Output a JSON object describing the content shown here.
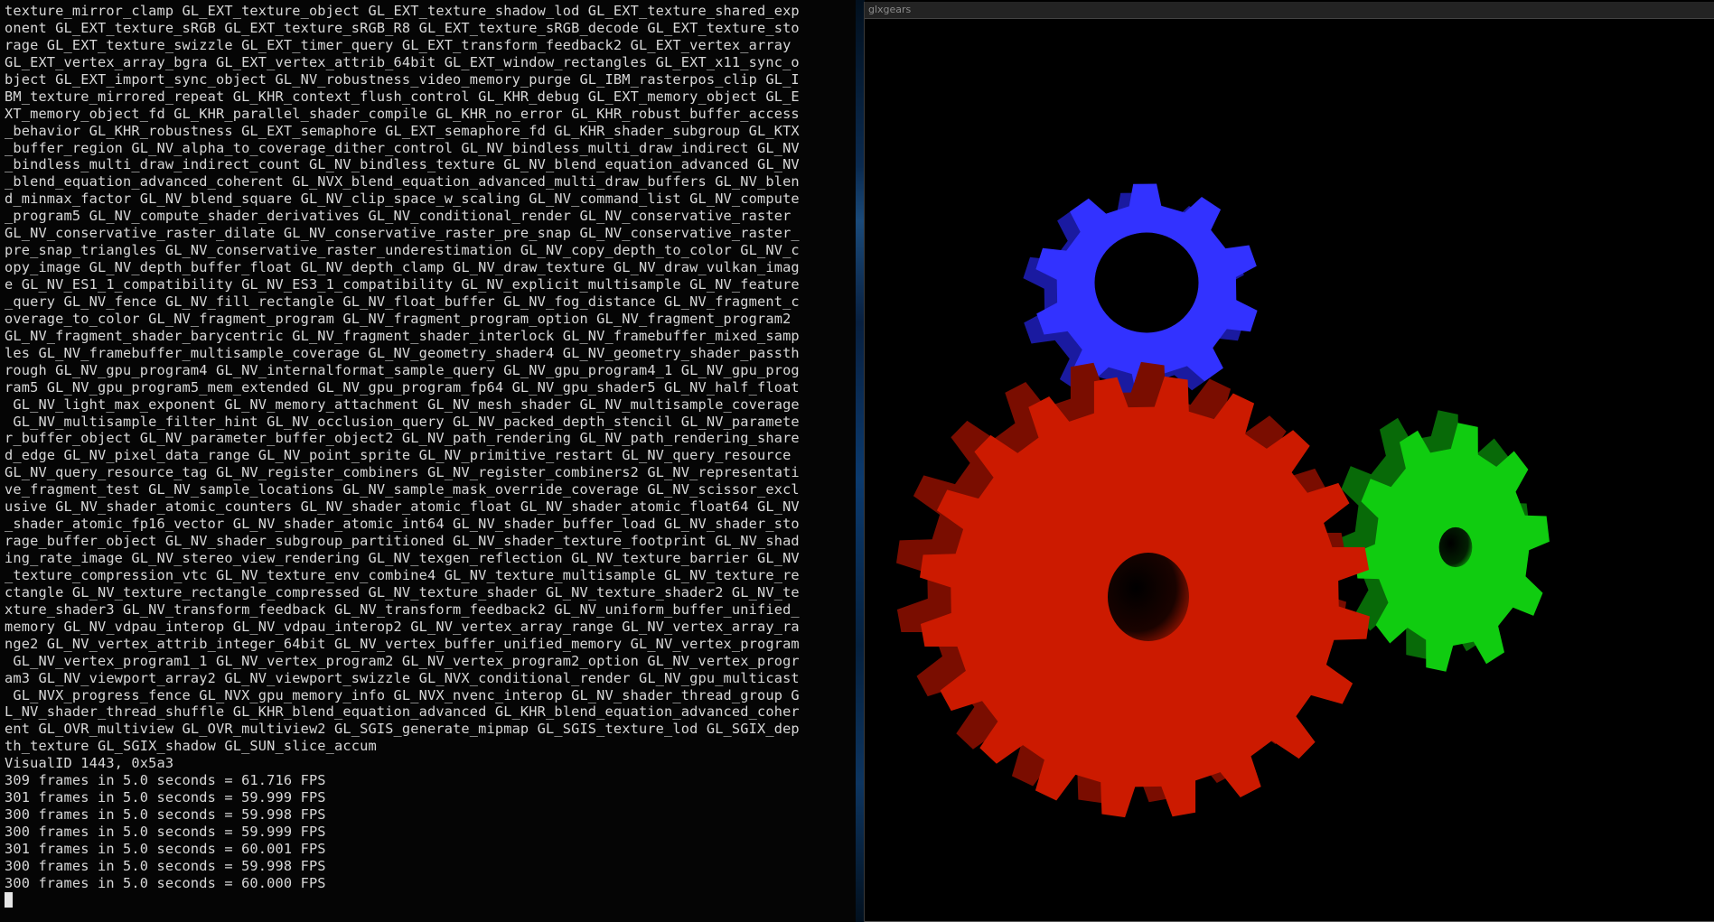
{
  "terminal": {
    "lines": [
      "texture_mirror_clamp GL_EXT_texture_object GL_EXT_texture_shadow_lod GL_EXT_texture_shared_exp",
      "onent GL_EXT_texture_sRGB GL_EXT_texture_sRGB_R8 GL_EXT_texture_sRGB_decode GL_EXT_texture_sto",
      "rage GL_EXT_texture_swizzle GL_EXT_timer_query GL_EXT_transform_feedback2 GL_EXT_vertex_array",
      "GL_EXT_vertex_array_bgra GL_EXT_vertex_attrib_64bit GL_EXT_window_rectangles GL_EXT_x11_sync_o",
      "bject GL_EXT_import_sync_object GL_NV_robustness_video_memory_purge GL_IBM_rasterpos_clip GL_I",
      "BM_texture_mirrored_repeat GL_KHR_context_flush_control GL_KHR_debug GL_EXT_memory_object GL_E",
      "XT_memory_object_fd GL_KHR_parallel_shader_compile GL_KHR_no_error GL_KHR_robust_buffer_access",
      "_behavior GL_KHR_robustness GL_EXT_semaphore GL_EXT_semaphore_fd GL_KHR_shader_subgroup GL_KTX",
      "_buffer_region GL_NV_alpha_to_coverage_dither_control GL_NV_bindless_multi_draw_indirect GL_NV",
      "_bindless_multi_draw_indirect_count GL_NV_bindless_texture GL_NV_blend_equation_advanced GL_NV",
      "_blend_equation_advanced_coherent GL_NVX_blend_equation_advanced_multi_draw_buffers GL_NV_blen",
      "d_minmax_factor GL_NV_blend_square GL_NV_clip_space_w_scaling GL_NV_command_list GL_NV_compute",
      "_program5 GL_NV_compute_shader_derivatives GL_NV_conditional_render GL_NV_conservative_raster",
      "GL_NV_conservative_raster_dilate GL_NV_conservative_raster_pre_snap GL_NV_conservative_raster_",
      "pre_snap_triangles GL_NV_conservative_raster_underestimation GL_NV_copy_depth_to_color GL_NV_c",
      "opy_image GL_NV_depth_buffer_float GL_NV_depth_clamp GL_NV_draw_texture GL_NV_draw_vulkan_imag",
      "e GL_NV_ES1_1_compatibility GL_NV_ES3_1_compatibility GL_NV_explicit_multisample GL_NV_feature",
      "_query GL_NV_fence GL_NV_fill_rectangle GL_NV_float_buffer GL_NV_fog_distance GL_NV_fragment_c",
      "overage_to_color GL_NV_fragment_program GL_NV_fragment_program_option GL_NV_fragment_program2",
      "GL_NV_fragment_shader_barycentric GL_NV_fragment_shader_interlock GL_NV_framebuffer_mixed_samp",
      "les GL_NV_framebuffer_multisample_coverage GL_NV_geometry_shader4 GL_NV_geometry_shader_passth",
      "rough GL_NV_gpu_program4 GL_NV_internalformat_sample_query GL_NV_gpu_program4_1 GL_NV_gpu_prog",
      "ram5 GL_NV_gpu_program5_mem_extended GL_NV_gpu_program_fp64 GL_NV_gpu_shader5 GL_NV_half_float",
      " GL_NV_light_max_exponent GL_NV_memory_attachment GL_NV_mesh_shader GL_NV_multisample_coverage",
      " GL_NV_multisample_filter_hint GL_NV_occlusion_query GL_NV_packed_depth_stencil GL_NV_paramete",
      "r_buffer_object GL_NV_parameter_buffer_object2 GL_NV_path_rendering GL_NV_path_rendering_share",
      "d_edge GL_NV_pixel_data_range GL_NV_point_sprite GL_NV_primitive_restart GL_NV_query_resource",
      "GL_NV_query_resource_tag GL_NV_register_combiners GL_NV_register_combiners2 GL_NV_representati",
      "ve_fragment_test GL_NV_sample_locations GL_NV_sample_mask_override_coverage GL_NV_scissor_excl",
      "usive GL_NV_shader_atomic_counters GL_NV_shader_atomic_float GL_NV_shader_atomic_float64 GL_NV",
      "_shader_atomic_fp16_vector GL_NV_shader_atomic_int64 GL_NV_shader_buffer_load GL_NV_shader_sto",
      "rage_buffer_object GL_NV_shader_subgroup_partitioned GL_NV_shader_texture_footprint GL_NV_shad",
      "ing_rate_image GL_NV_stereo_view_rendering GL_NV_texgen_reflection GL_NV_texture_barrier GL_NV",
      "_texture_compression_vtc GL_NV_texture_env_combine4 GL_NV_texture_multisample GL_NV_texture_re",
      "ctangle GL_NV_texture_rectangle_compressed GL_NV_texture_shader GL_NV_texture_shader2 GL_NV_te",
      "xture_shader3 GL_NV_transform_feedback GL_NV_transform_feedback2 GL_NV_uniform_buffer_unified_",
      "memory GL_NV_vdpau_interop GL_NV_vdpau_interop2 GL_NV_vertex_array_range GL_NV_vertex_array_ra",
      "nge2 GL_NV_vertex_attrib_integer_64bit GL_NV_vertex_buffer_unified_memory GL_NV_vertex_program",
      " GL_NV_vertex_program1_1 GL_NV_vertex_program2 GL_NV_vertex_program2_option GL_NV_vertex_progr",
      "am3 GL_NV_viewport_array2 GL_NV_viewport_swizzle GL_NVX_conditional_render GL_NV_gpu_multicast",
      " GL_NVX_progress_fence GL_NVX_gpu_memory_info GL_NVX_nvenc_interop GL_NV_shader_thread_group G",
      "L_NV_shader_thread_shuffle GL_KHR_blend_equation_advanced GL_KHR_blend_equation_advanced_coher",
      "ent GL_OVR_multiview GL_OVR_multiview2 GL_SGIS_generate_mipmap GL_SGIS_texture_lod GL_SGIX_dep",
      "th_texture GL_SGIX_shadow GL_SUN_slice_accum",
      "VisualID 1443, 0x5a3",
      "309 frames in 5.0 seconds = 61.716 FPS",
      "301 frames in 5.0 seconds = 59.999 FPS",
      "300 frames in 5.0 seconds = 59.998 FPS",
      "300 frames in 5.0 seconds = 59.999 FPS",
      "301 frames in 5.0 seconds = 60.001 FPS",
      "300 frames in 5.0 seconds = 59.998 FPS",
      "300 frames in 5.0 seconds = 60.000 FPS"
    ]
  },
  "glxgears": {
    "title": "glxgears",
    "gears": [
      {
        "name": "blue-gear",
        "teeth": 10,
        "color": "#3232ff",
        "side_color": "#1a1aa0"
      },
      {
        "name": "red-gear",
        "teeth": 20,
        "color": "#cc1a00",
        "side_color": "#7a0d00"
      },
      {
        "name": "green-gear",
        "teeth": 10,
        "color": "#10cc10",
        "side_color": "#086a08"
      }
    ]
  },
  "colors": {
    "terminal_bg": "#050505",
    "terminal_fg": "#d8d8d8",
    "window_bg": "#000000"
  }
}
